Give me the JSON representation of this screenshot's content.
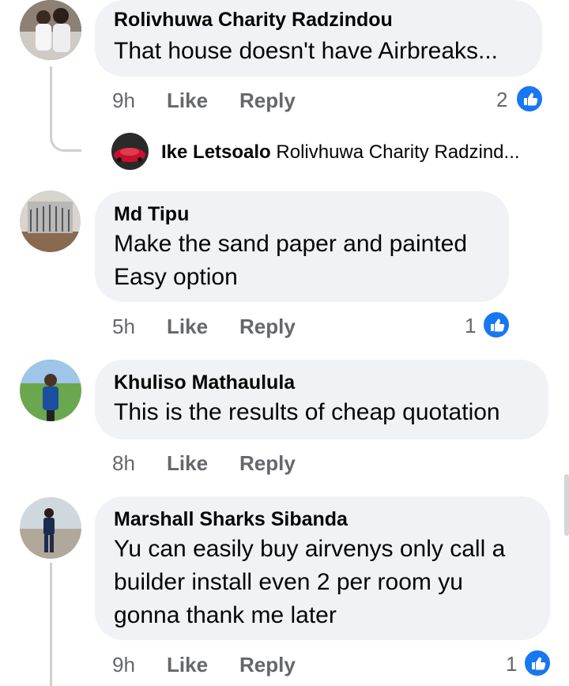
{
  "comments": [
    {
      "author": "Rolivhuwa Charity Radzindou",
      "lines": [
        "That house doesn't have Airbreaks..."
      ],
      "time": "9h",
      "like": "Like",
      "reply": "Reply",
      "reactions": "2",
      "reply_preview": {
        "author": "Ike Letsoalo",
        "text": "Rolivhuwa Charity Radzind..."
      }
    },
    {
      "author": "Md Tipu",
      "lines": [
        "Make the sand paper and painted",
        "Easy option"
      ],
      "time": "5h",
      "like": "Like",
      "reply": "Reply",
      "reactions": "1"
    },
    {
      "author": "Khuliso Mathaulula",
      "lines": [
        "This is the results of cheap quotation"
      ],
      "time": "8h",
      "like": "Like",
      "reply": "Reply"
    },
    {
      "author": "Marshall Sharks Sibanda",
      "lines": [
        "Yu can easily buy airvenys only call a",
        "builder install even 2 per room yu",
        "gonna thank me later"
      ],
      "time": "9h",
      "like": "Like",
      "reply": "Reply",
      "reactions": "1"
    }
  ],
  "colors": {
    "bubble": "#f0f2f5",
    "action": "#65676b",
    "like_blue": "#1877f2"
  },
  "icons": [
    "like-reaction-icon"
  ]
}
